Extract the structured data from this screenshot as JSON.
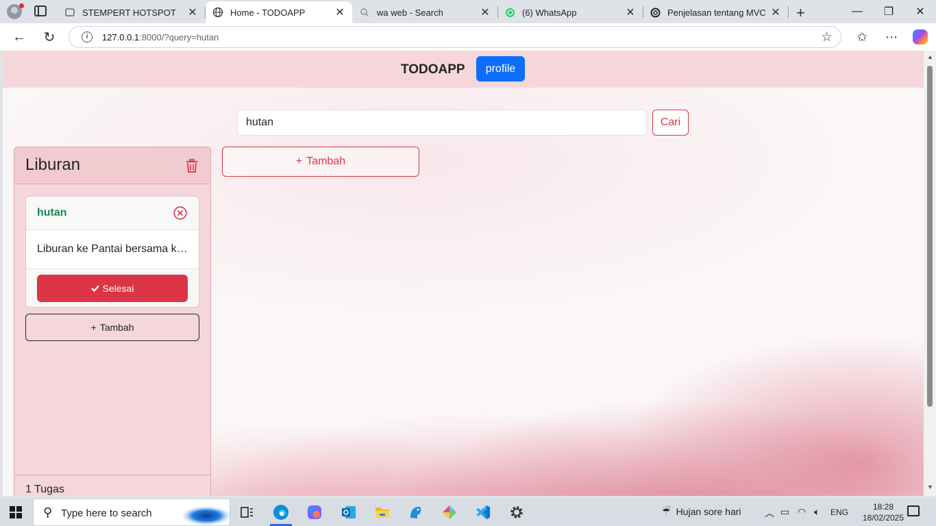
{
  "browser": {
    "tabs": [
      {
        "label": "STEMPERT HOTSPOT",
        "icon": "page-icon"
      },
      {
        "label": "Home - TODOAPP",
        "icon": "globe-icon"
      },
      {
        "label": "wa web - Search",
        "icon": "search-icon"
      },
      {
        "label": "(6) WhatsApp",
        "icon": "whatsapp-icon"
      },
      {
        "label": "Penjelasan tentang MVC",
        "icon": "openai-icon"
      }
    ],
    "url_host": "127.0.0.1",
    "url_rest": ":8000/?query=hutan"
  },
  "app": {
    "brand": "TODOAPP",
    "profile_label": "profile",
    "search_value": "hutan",
    "search_button": "Cari",
    "add_list_label": "Tambah",
    "list": {
      "title": "Liburan",
      "task": {
        "title": "hutan",
        "description": "Liburan ke Pantai bersama keluarga",
        "done_label": "Selesai"
      },
      "add_task_label": "Tambah",
      "count_label": "1 Tugas"
    },
    "colors": {
      "accent_red": "#dc3545",
      "primary_blue": "#0d6efd",
      "task_green": "#198754",
      "navbar_pink": "#f5d6da"
    }
  },
  "taskbar": {
    "search_placeholder": "Type here to search",
    "weather": "Hujan sore hari",
    "lang": "ENG",
    "time": "18:28",
    "date": "18/02/2025"
  }
}
